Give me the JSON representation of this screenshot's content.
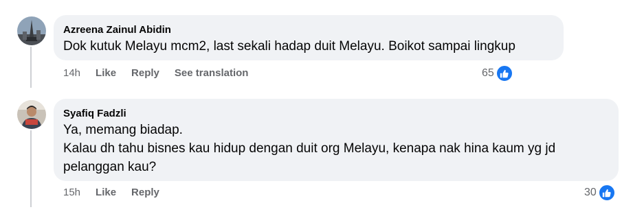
{
  "comments": [
    {
      "author": "Azreena Zainul Abidin",
      "lines": [
        "Dok kutuk Melayu mcm2, last sekali hadap duit Melayu. Boikot sampai lingkup"
      ],
      "time": "14h",
      "like_label": "Like",
      "reply_label": "Reply",
      "translate_label": "See translation",
      "reaction_count": "65",
      "reaction_icon": "like-icon"
    },
    {
      "author": "Syafiq Fadzli",
      "lines": [
        "Ya, memang biadap.",
        "Kalau dh tahu bisnes kau hidup dengan duit org Melayu, kenapa nak hina kaum yg jd",
        "pelanggan kau?"
      ],
      "time": "15h",
      "like_label": "Like",
      "reply_label": "Reply",
      "reaction_count": "30",
      "reaction_icon": "like-icon"
    }
  ],
  "colors": {
    "like_blue": "#1877f2",
    "bubble_bg": "#f0f2f5",
    "meta_gray": "#65676b"
  }
}
